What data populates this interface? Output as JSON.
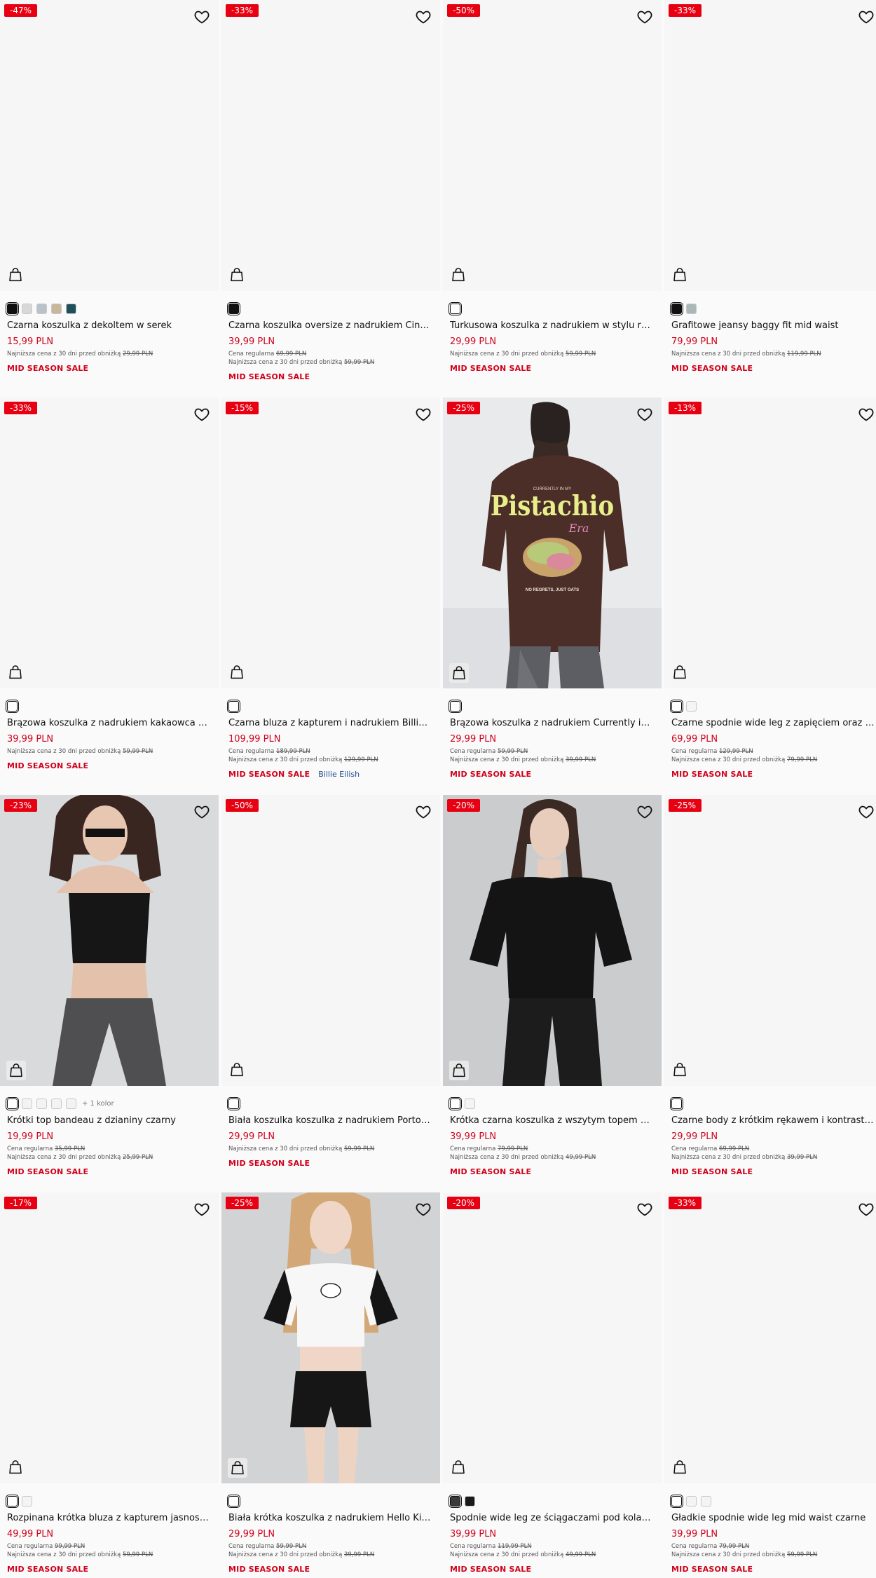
{
  "products": [
    {
      "badge": "-47%",
      "name": "Czarna koszulka z dekoltem w serek",
      "price": "15,99 PLN",
      "regular": null,
      "lowest_label": "Najniższa cena z 30 dni przed obniżką",
      "lowest": "29,99 PLN",
      "tags": [
        "MID SEASON SALE"
      ],
      "swatches": [
        "#111111",
        "#d8d8d8",
        "#b9c2c9",
        "#c9b79b",
        "#1f4f5a"
      ],
      "more": null,
      "photo": null
    },
    {
      "badge": "-33%",
      "name": "Czarna koszulka oversize z nadrukiem Cinnamoroll",
      "price": "39,99 PLN",
      "regular_label": "Cena regularna",
      "regular": "69,99 PLN",
      "lowest_label": "Najniższa cena z 30 dni przed obniżką",
      "lowest": "59,99 PLN",
      "tags": [
        "MID SEASON SALE"
      ],
      "swatches": [
        "#111111"
      ],
      "more": null,
      "photo": null
    },
    {
      "badge": "-50%",
      "name": "Turkusowa koszulka z nadrukiem w stylu rustykalnym",
      "price": "29,99 PLN",
      "regular": null,
      "lowest_label": "Najniższa cena z 30 dni przed obniżką",
      "lowest": "59,99 PLN",
      "tags": [
        "MID SEASON SALE"
      ],
      "swatches": [
        "#ffffff"
      ],
      "more": null,
      "photo": null
    },
    {
      "badge": "-33%",
      "name": "Grafitowe jeansy baggy fit mid waist",
      "price": "79,99 PLN",
      "regular": null,
      "lowest_label": "Najniższa cena z 30 dni przed obniżką",
      "lowest": "119,99 PLN",
      "tags": [
        "MID SEASON SALE"
      ],
      "swatches": [
        "#111111",
        "#a9b8b6"
      ],
      "more": null,
      "photo": null
    },
    {
      "badge": "-33%",
      "name": "Brązowa koszulka z nadrukiem kakaowca z napisem",
      "price": "39,99 PLN",
      "regular": null,
      "lowest_label": "Najniższa cena z 30 dni przed obniżką",
      "lowest": "59,99 PLN",
      "tags": [
        "MID SEASON SALE"
      ],
      "swatches": [
        "#ffffff"
      ],
      "more": null,
      "photo": null
    },
    {
      "badge": "-15%",
      "name": "Czarna bluza z kapturem i nadrukiem Billie Eilish",
      "price": "109,99 PLN",
      "regular_label": "Cena regularna",
      "regular": "189,99 PLN",
      "lowest_label": "Najniższa cena z 30 dni przed obniżką",
      "lowest": "129,99 PLN",
      "tags": [
        "MID SEASON SALE",
        "Billie Eilish"
      ],
      "swatches": [
        "#ffffff"
      ],
      "more": null,
      "photo": null
    },
    {
      "badge": "-25%",
      "name": "Brązowa koszulka z nadrukiem Currently in my Pistachio Era",
      "price": "29,99 PLN",
      "regular_label": "Cena regularna",
      "regular": "59,99 PLN",
      "lowest_label": "Najniższa cena z 30 dni przed obniżką",
      "lowest": "39,99 PLN",
      "tags": [
        "MID SEASON SALE"
      ],
      "swatches": [
        "#ffffff"
      ],
      "more": null,
      "photo": "pistachio",
      "print": {
        "top": "CURRENTLY IN MY",
        "main": "Pistachio",
        "era": "Era",
        "bottom": "NO REGRETS, JUST OATS"
      }
    },
    {
      "badge": "-13%",
      "name": "Czarne spodnie wide leg z zapięciem oraz wiązaniem",
      "price": "69,99 PLN",
      "regular_label": "Cena regularna",
      "regular": "129,99 PLN",
      "lowest_label": "Najniższa cena z 30 dni przed obniżką",
      "lowest": "79,99 PLN",
      "tags": [
        "MID SEASON SALE"
      ],
      "swatches": [
        "#ffffff",
        "#f4f4f4"
      ],
      "more": null,
      "photo": null
    },
    {
      "badge": "-23%",
      "name": "Krótki top bandeau z dzianiny czarny",
      "price": "19,99 PLN",
      "regular_label": "Cena regularna",
      "regular": "35,99 PLN",
      "lowest_label": "Najniższa cena z 30 dni przed obniżką",
      "lowest": "25,99 PLN",
      "tags": [
        "MID SEASON SALE"
      ],
      "swatches": [
        "#ffffff",
        "#f3f3f3",
        "#f3f3f3",
        "#f3f3f3",
        "#f3f3f3"
      ],
      "more": "+ 1 kolor",
      "photo": "bandeau"
    },
    {
      "badge": "-50%",
      "name": "Biała koszulka koszulka z nadrukiem Portofino",
      "price": "29,99 PLN",
      "regular": null,
      "lowest_label": "Najniższa cena z 30 dni przed obniżką",
      "lowest": "59,99 PLN",
      "tags": [
        "MID SEASON SALE"
      ],
      "swatches": [
        "#ffffff"
      ],
      "more": null,
      "photo": null
    },
    {
      "badge": "-20%",
      "name": "Krótka czarna koszulka z wszytym topem na ramiączkach",
      "price": "39,99 PLN",
      "regular_label": "Cena regularna",
      "regular": "79,99 PLN",
      "lowest_label": "Najniższa cena z 30 dni przed obniżką",
      "lowest": "49,99 PLN",
      "tags": [
        "MID SEASON SALE"
      ],
      "swatches": [
        "#ffffff",
        "#f4f4f4"
      ],
      "more": null,
      "photo": "blacktop"
    },
    {
      "badge": "-25%",
      "name": "Czarne body z krótkim rękawem i kontrastowym wykończeniem",
      "price": "29,99 PLN",
      "regular_label": "Cena regularna",
      "regular": "69,99 PLN",
      "lowest_label": "Najniższa cena z 30 dni przed obniżką",
      "lowest": "39,99 PLN",
      "tags": [
        "MID SEASON SALE"
      ],
      "swatches": [
        "#ffffff"
      ],
      "more": null,
      "photo": null
    },
    {
      "badge": "-17%",
      "name": "Rozpinana krótka bluza z kapturem jasnoszara",
      "price": "49,99 PLN",
      "regular_label": "Cena regularna",
      "regular": "99,99 PLN",
      "lowest_label": "Najniższa cena z 30 dni przed obniżką",
      "lowest": "59,99 PLN",
      "tags": [
        "MID SEASON SALE"
      ],
      "swatches": [
        "#ffffff",
        "#f4f4f4"
      ],
      "more": null,
      "photo": null
    },
    {
      "badge": "-25%",
      "name": "Biała krótka koszulka z nadrukiem Hello Kitty",
      "price": "29,99 PLN",
      "regular_label": "Cena regularna",
      "regular": "59,99 PLN",
      "lowest_label": "Najniższa cena z 30 dni przed obniżką",
      "lowest": "39,99 PLN",
      "tags": [
        "MID SEASON SALE"
      ],
      "swatches": [
        "#ffffff"
      ],
      "more": null,
      "photo": "hellokitty"
    },
    {
      "badge": "-20%",
      "name": "Spodnie wide leg ze ściągaczami pod kolanem",
      "price": "39,99 PLN",
      "regular_label": "Cena regularna",
      "regular": "119,99 PLN",
      "lowest_label": "Najniższa cena z 30 dni przed obniżką",
      "lowest": "49,99 PLN",
      "tags": [
        "MID SEASON SALE"
      ],
      "swatches": [
        "#3a3a3a",
        "#1a1a1a"
      ],
      "more": null,
      "photo": null
    },
    {
      "badge": "-33%",
      "name": "Gładkie spodnie wide leg mid waist czarne",
      "price": "39,99 PLN",
      "regular_label": "Cena regularna",
      "regular": "79,99 PLN",
      "lowest_label": "Najniższa cena z 30 dni przed obniżką",
      "lowest": "59,99 PLN",
      "tags": [
        "MID SEASON SALE"
      ],
      "swatches": [
        "#ffffff",
        "#f4f4f4",
        "#f4f4f4"
      ],
      "more": null,
      "photo": null
    }
  ],
  "colors": {
    "badge": "#e60012",
    "price": "#d0021b",
    "brand_tag": "#1e4a8c"
  },
  "icons": {
    "wishlist": "heart-icon",
    "add_to_bag": "shopping-bag-icon"
  }
}
